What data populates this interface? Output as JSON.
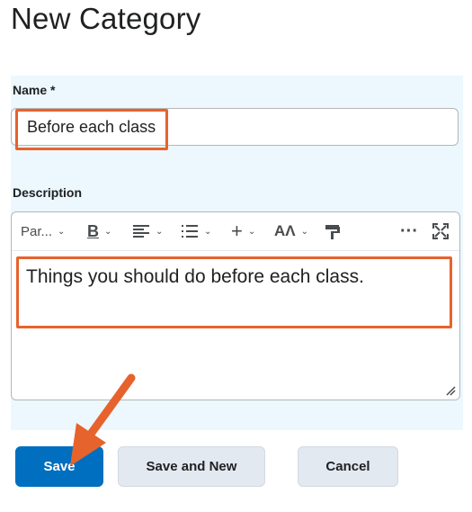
{
  "page": {
    "title": "New Category"
  },
  "form": {
    "name_label": "Name *",
    "name_value": "Before each class",
    "description_label": "Description",
    "description_text": "Things you should do before each class."
  },
  "toolbar": {
    "paragraph_label": "Par...",
    "bold_label": "B",
    "items": [
      "paragraph-format",
      "bold",
      "align",
      "list",
      "insert",
      "font-style",
      "format-painter",
      "more",
      "fullscreen"
    ]
  },
  "buttons": {
    "save": "Save",
    "save_and_new": "Save and New",
    "cancel": "Cancel"
  },
  "colors": {
    "primary": "#006fbf",
    "highlight": "#e6632d",
    "panel": "#ecf8fd"
  }
}
